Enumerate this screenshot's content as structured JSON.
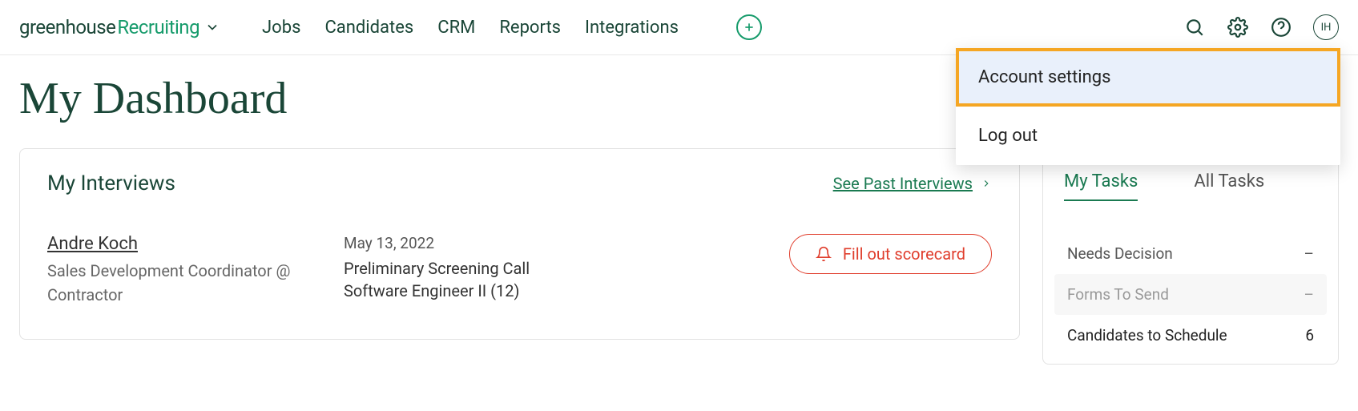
{
  "brand": {
    "greenhouse": "greenhouse",
    "recruiting": "Recruiting"
  },
  "nav": {
    "jobs": "Jobs",
    "candidates": "Candidates",
    "crm": "CRM",
    "reports": "Reports",
    "integrations": "Integrations"
  },
  "avatar_initials": "IH",
  "user_menu": {
    "account_settings": "Account settings",
    "log_out": "Log out"
  },
  "page_title": "My Dashboard",
  "interviews": {
    "title": "My Interviews",
    "see_past": "See Past Interviews",
    "row": {
      "candidate_name": "Andre Koch",
      "candidate_role": "Sales Development Coordinator @ Contractor",
      "date": "May 13, 2022",
      "stage": "Preliminary Screening Call",
      "job": "Software Engineer II (12)",
      "scorecard_label": "Fill out scorecard"
    }
  },
  "tasks": {
    "tab_my": "My Tasks",
    "tab_all": "All Tasks",
    "rows": {
      "needs_decision": {
        "label": "Needs Decision",
        "value": "–"
      },
      "forms_to_send": {
        "label": "Forms To Send",
        "value": "–"
      },
      "candidates_to_schedule": {
        "label": "Candidates to Schedule",
        "value": "6"
      }
    }
  }
}
